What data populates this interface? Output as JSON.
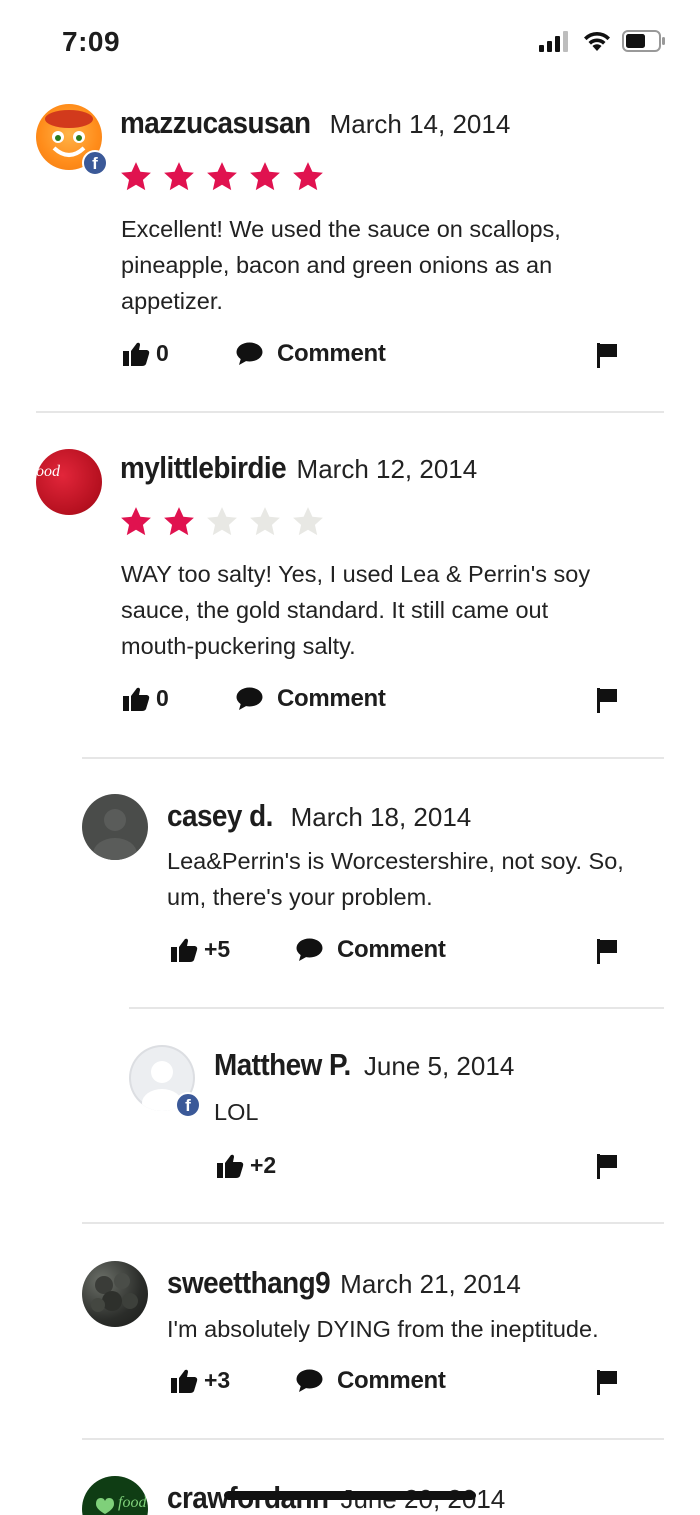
{
  "status_bar": {
    "time": "7:09",
    "icons": [
      "cellular-signal-icon",
      "wifi-icon",
      "battery-icon"
    ]
  },
  "colors": {
    "star_filled": "#e0124f",
    "star_empty": "#e8e8e4",
    "divider": "#e6e6e6",
    "facebook": "#3b5998"
  },
  "reviews": [
    {
      "username": "mazzucasusan",
      "date": "March 14, 2014",
      "rating": 5,
      "rating_max": 5,
      "text": "Excellent! We used the sauce on scallops, pineapple, bacon and green onions as an appetizer.",
      "likes": "0",
      "comment_label": "Comment",
      "facebook": true
    },
    {
      "username": "mylittlebirdie",
      "date": "March 12, 2014",
      "rating": 2,
      "rating_max": 5,
      "text": "WAY too salty! Yes, I used Lea & Perrin's soy sauce, the gold standard. It still came out mouth-puckering salty.",
      "likes": "0",
      "comment_label": "Comment",
      "facebook": false,
      "avatar_text": "ood"
    }
  ],
  "replies": [
    {
      "username": "casey d.",
      "date": "March 18, 2014",
      "text": "Lea&Perrin's is Worcestershire, not soy. So, um, there's your problem.",
      "likes": "+5",
      "comment_label": "Comment"
    },
    {
      "username": "Matthew P.",
      "date": "June 5, 2014",
      "text": "LOL",
      "likes": "+2",
      "facebook": true
    },
    {
      "username": "sweetthang9",
      "date": "March 21, 2014",
      "text": "I'm absolutely DYING from the ineptitude.",
      "likes": "+3",
      "comment_label": "Comment"
    },
    {
      "username": "crawfordann",
      "date": "June 20, 2014",
      "avatar_text": "food"
    }
  ]
}
